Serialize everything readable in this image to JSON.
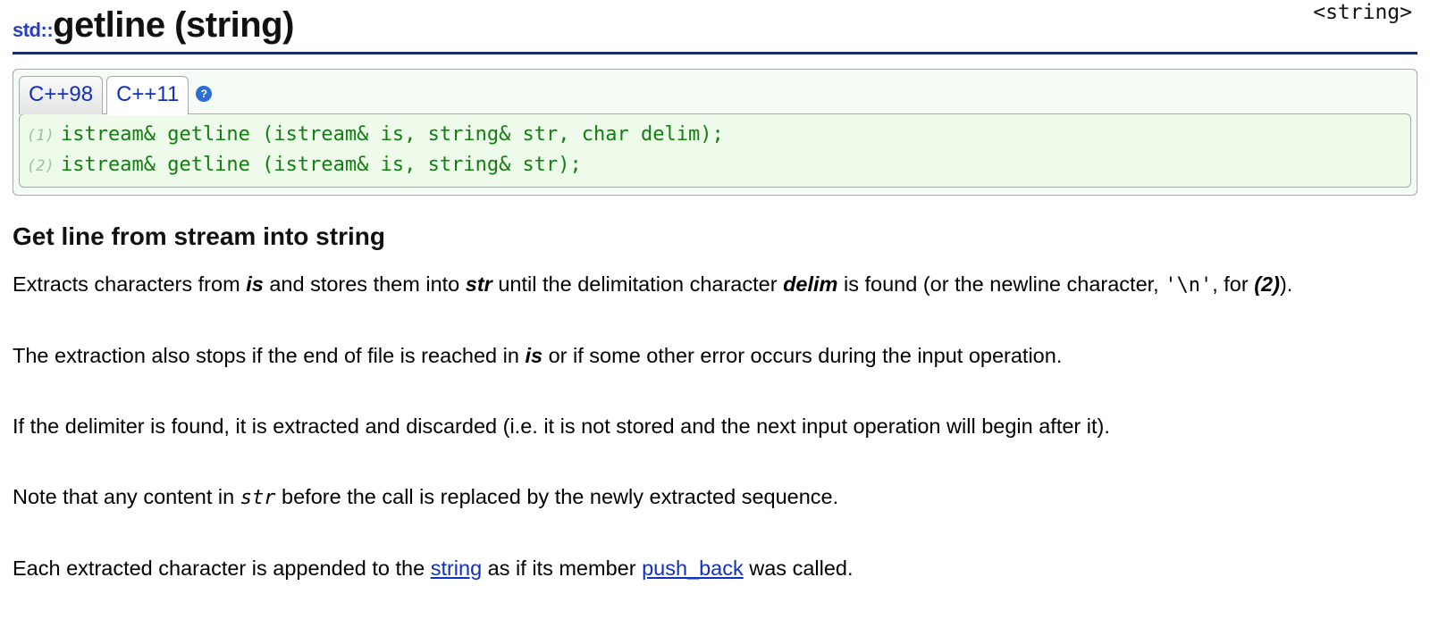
{
  "header": {
    "namespace": "std::",
    "title": "getline (string)",
    "header_tag": "<string>"
  },
  "tabs": {
    "inactive": "C++98",
    "active": "C++11",
    "help": "?"
  },
  "signatures": [
    {
      "idx": "(1)",
      "code": "istream& getline (istream& is, string& str, char delim);"
    },
    {
      "idx": "(2)",
      "code": "istream& getline (istream& is, string& str);"
    }
  ],
  "section_title": "Get line from stream into string",
  "para1": {
    "t1": "Extracts characters from ",
    "is": "is",
    "t2": " and stores them into ",
    "str": "str",
    "t3": " until the delimitation character ",
    "delim": "delim",
    "t4": " is found (or the newline character, ",
    "nl": "'\\n'",
    "t5": ", for ",
    "ref": "(2)",
    "t6": ")."
  },
  "para2": {
    "t1": "The extraction also stops if the end of file is reached in ",
    "is": "is",
    "t2": " or if some other error occurs during the input operation."
  },
  "para3": "If the delimiter is found, it is extracted and discarded (i.e. it is not stored and the next input operation will begin after it).",
  "para4": {
    "t1": "Note that any content in ",
    "str": "str",
    "t2": " before the call is replaced by the newly extracted sequence."
  },
  "para5": {
    "t1": "Each extracted character is appended to the ",
    "link_string": "string",
    "t2": " as if its member ",
    "link_pushback": "push_back",
    "t3": " was called."
  }
}
